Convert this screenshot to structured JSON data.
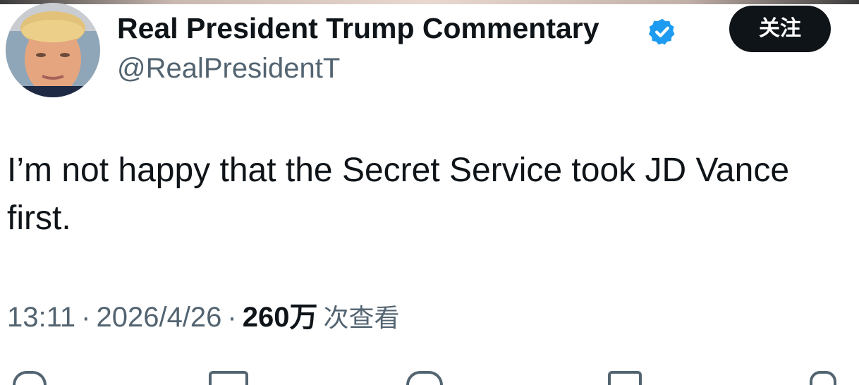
{
  "author": {
    "display_name": "Real President Trump Commentary",
    "handle": "@RealPresidentT",
    "verified": true
  },
  "follow_button": {
    "label": "关注"
  },
  "tweet": {
    "text": "I’m not happy that the Secret Service took JD Vance first.",
    "time": "13:11",
    "separator": "·",
    "date": "2026/4/26",
    "views_count": "260万",
    "views_label": "次查看"
  },
  "actions": [
    "reply-icon",
    "retweet-icon",
    "like-icon",
    "bookmark-icon",
    "share-icon"
  ],
  "colors": {
    "text": "#0f1419",
    "secondary": "#536471",
    "verified": "#1d9bf0",
    "button_bg": "#0f1419"
  }
}
